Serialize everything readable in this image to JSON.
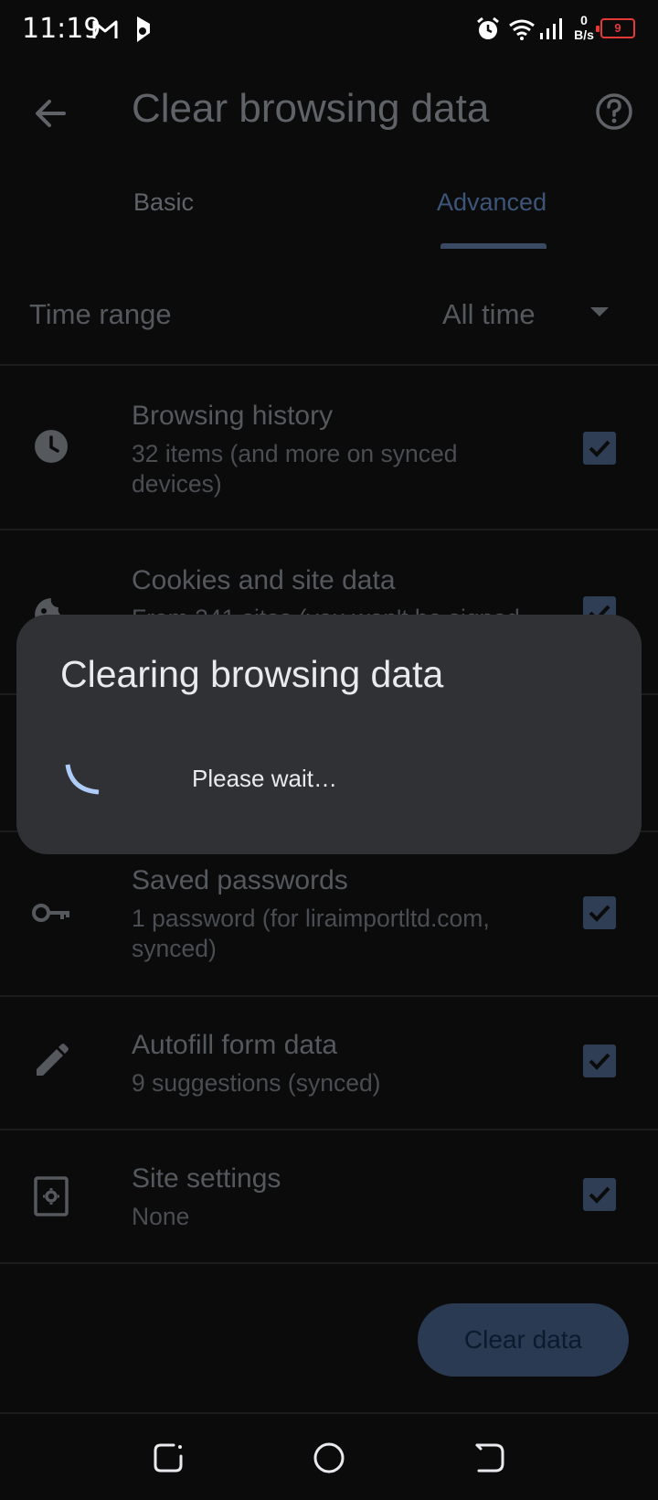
{
  "status_bar": {
    "time": "11:19",
    "network_speed_value": "0",
    "network_speed_unit": "B/s",
    "battery_level": "9"
  },
  "app_bar": {
    "title": "Clear browsing data"
  },
  "tabs": [
    {
      "label": "Basic",
      "selected": false
    },
    {
      "label": "Advanced",
      "selected": true
    }
  ],
  "time_range": {
    "label": "Time range",
    "value": "All time"
  },
  "items": [
    {
      "icon": "clock-icon",
      "title": "Browsing history",
      "subtitle": "32 items (and more on synced devices)",
      "checked": true
    },
    {
      "icon": "cookie-icon",
      "title": "Cookies and site data",
      "subtitle": "From 241 sites (you won't be signed",
      "checked": true
    },
    {
      "icon": "key-icon",
      "title": "Saved passwords",
      "subtitle": "1 password (for liraimportltd.com, synced)",
      "checked": true
    },
    {
      "icon": "pencil-icon",
      "title": "Autofill form data",
      "subtitle": "9 suggestions (synced)",
      "checked": true
    },
    {
      "icon": "site-settings-icon",
      "title": "Site settings",
      "subtitle": "None",
      "checked": true
    }
  ],
  "clear_button": {
    "label": "Clear data"
  },
  "dialog": {
    "title": "Clearing browsing data",
    "message": "Please wait…"
  },
  "colors": {
    "background": "#0b0b0c",
    "dialog_background": "#2f3134",
    "accent": "#aecbfa",
    "checkbox_dimmed": "#2f3e54",
    "battery_low": "#e53935"
  }
}
